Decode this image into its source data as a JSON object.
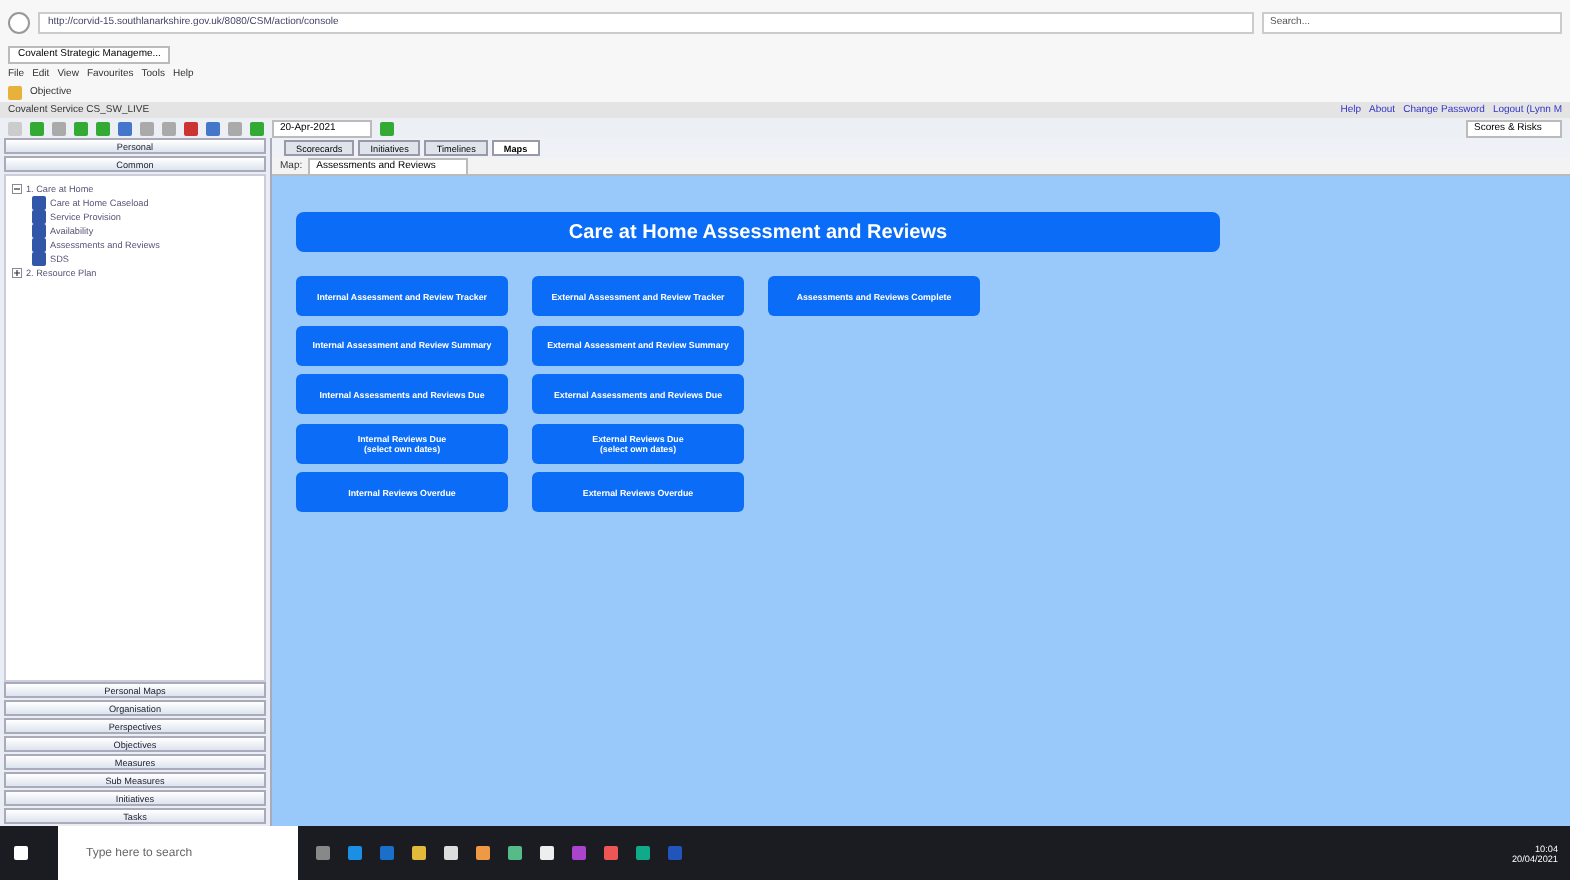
{
  "browser": {
    "address": "http://corvid-15.southlanarkshire.gov.uk/8080/CSM/action/console",
    "search": {
      "placeholder": "Search..."
    },
    "tab": "Covalent Strategic Manageme...",
    "menu": [
      "File",
      "Edit",
      "View",
      "Favourites",
      "Tools",
      "Help"
    ],
    "favourite": "Objective"
  },
  "app": {
    "title": "Covalent Service CS_SW_LIVE",
    "links": [
      "Help",
      "About",
      "Change Password",
      "Logout (Lynn M"
    ],
    "date": "20-Apr-2021",
    "view_select": "Scores & Risks"
  },
  "sidebar": {
    "top_sections": [
      "Personal",
      "Common"
    ],
    "tree": [
      {
        "label": "1. Care at Home",
        "expanded": true,
        "children": [
          {
            "label": "Care at Home Caseload"
          },
          {
            "label": "Service Provision"
          },
          {
            "label": "Availability"
          },
          {
            "label": "Assessments and Reviews"
          },
          {
            "label": "SDS"
          }
        ]
      },
      {
        "label": "2. Resource Plan",
        "expanded": false
      }
    ],
    "bottom_sections": [
      "Personal Maps",
      "Organisation",
      "Perspectives",
      "Objectives",
      "Measures",
      "Sub Measures",
      "Initiatives",
      "Tasks"
    ]
  },
  "tabs": [
    {
      "label": "Scorecards",
      "selected": false
    },
    {
      "label": "Initiatives",
      "selected": false
    },
    {
      "label": "Timelines",
      "selected": false
    },
    {
      "label": "Maps",
      "selected": true
    }
  ],
  "map": {
    "label": "Map:",
    "name": "Assessments and Reviews",
    "title": "Care at Home Assessment and Reviews",
    "columns": [
      [
        "Internal Assessment and Review Tracker",
        "Internal Assessment and Review Summary",
        "Internal Assessments and Reviews Due",
        "Internal Reviews Due\n(select own dates)",
        "Internal Reviews Overdue"
      ],
      [
        "External Assessment and Review Tracker",
        "External Assessment and Review Summary",
        "External Assessments and Reviews Due",
        "External Reviews Due\n(select own dates)",
        "External Reviews Overdue"
      ],
      [
        "Assessments and Reviews Complete"
      ]
    ]
  },
  "taskbar": {
    "search": {
      "placeholder": "Type here to search"
    },
    "time": "10:04",
    "date": "20/04/2021"
  }
}
